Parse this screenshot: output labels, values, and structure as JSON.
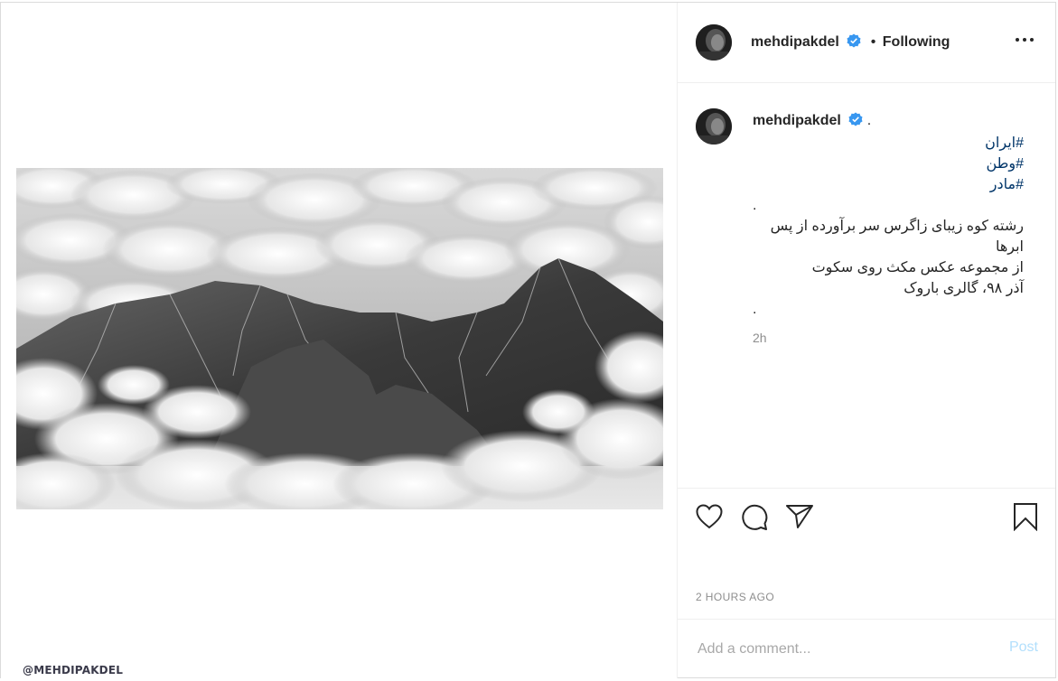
{
  "media": {
    "description_icon": "mountains-above-clouds-photo",
    "watermark": "@MEHDIPAKDEL"
  },
  "header": {
    "username": "mehdipakdel",
    "verified_icon": "verified-badge-icon",
    "separator": "•",
    "follow_status": "Following",
    "more_icon": "more-options-icon"
  },
  "caption": {
    "username": "mehdipakdel",
    "lines": [
      {
        "text": ".",
        "type": "text"
      },
      {
        "text": "#ایران",
        "type": "tag"
      },
      {
        "text": "#وطن",
        "type": "tag"
      },
      {
        "text": "#مادر",
        "type": "tag"
      },
      {
        "text": ".",
        "type": "text"
      },
      {
        "text": "رشته کوه زیبای زاگرس سر برآورده از پس",
        "type": "text"
      },
      {
        "text": "ابرها",
        "type": "text"
      },
      {
        "text": "از مجموعه عکس مکث روی سکوت",
        "type": "text"
      },
      {
        "text": "آذر ۹۸، گالری باروک",
        "type": "text"
      },
      {
        "text": ".",
        "type": "text"
      }
    ],
    "relative_time": "2h"
  },
  "actions": {
    "like_icon": "heart-icon",
    "comment_icon": "comment-icon",
    "share_icon": "share-icon",
    "save_icon": "bookmark-icon",
    "timestamp": "2 HOURS AGO"
  },
  "comment": {
    "placeholder": "Add a comment...",
    "post_label": "Post"
  },
  "colors": {
    "verified": "#3897f0",
    "hashtag": "#003569",
    "post_disabled": "#b2dffc",
    "muted": "#8e8e8e"
  }
}
